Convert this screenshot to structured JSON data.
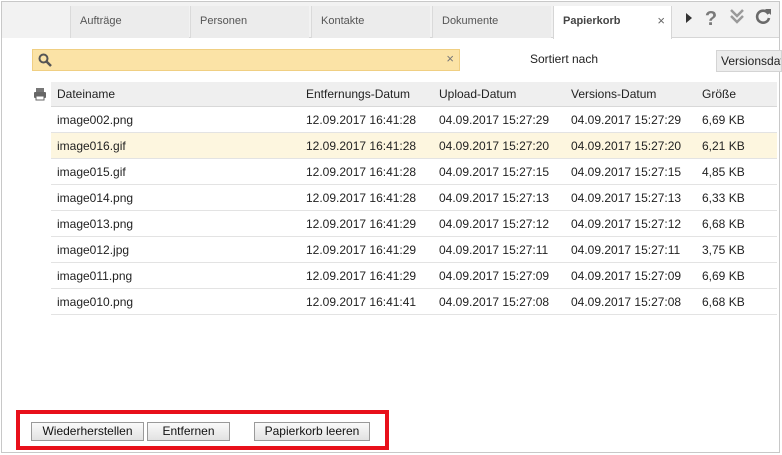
{
  "tabs": [
    {
      "label": "Aufträge"
    },
    {
      "label": "Personen"
    },
    {
      "label": "Kontakte"
    },
    {
      "label": "Dokumente"
    },
    {
      "label": "Papierkorb",
      "active": true
    }
  ],
  "toolbar_icons": [
    "play-icon",
    "help-icon",
    "chevrons-down-icon",
    "refresh-icon"
  ],
  "search": {
    "value": "",
    "placeholder": ""
  },
  "sort": {
    "label": "Sortiert nach",
    "selected": "Versionsdatum"
  },
  "table": {
    "columns": [
      "Dateiname",
      "Entfernungs-Datum",
      "Upload-Datum",
      "Versions-Datum",
      "Größe"
    ],
    "rows": [
      [
        "image002.png",
        "12.09.2017 16:41:28",
        "04.09.2017 15:27:29",
        "04.09.2017 15:27:29",
        "6,69 KB"
      ],
      [
        "image016.gif",
        "12.09.2017 16:41:28",
        "04.09.2017 15:27:20",
        "04.09.2017 15:27:20",
        "6,21 KB"
      ],
      [
        "image015.gif",
        "12.09.2017 16:41:28",
        "04.09.2017 15:27:15",
        "04.09.2017 15:27:15",
        "4,85 KB"
      ],
      [
        "image014.png",
        "12.09.2017 16:41:28",
        "04.09.2017 15:27:13",
        "04.09.2017 15:27:13",
        "6,33 KB"
      ],
      [
        "image013.png",
        "12.09.2017 16:41:29",
        "04.09.2017 15:27:12",
        "04.09.2017 15:27:12",
        "6,68 KB"
      ],
      [
        "image012.jpg",
        "12.09.2017 16:41:29",
        "04.09.2017 15:27:11",
        "04.09.2017 15:27:11",
        "3,75 KB"
      ],
      [
        "image011.png",
        "12.09.2017 16:41:29",
        "04.09.2017 15:27:09",
        "04.09.2017 15:27:09",
        "6,69 KB"
      ],
      [
        "image010.png",
        "12.09.2017 16:41:41",
        "04.09.2017 15:27:08",
        "04.09.2017 15:27:08",
        "6,68 KB"
      ]
    ],
    "selected_row": 1
  },
  "buttons": {
    "restore": "Wiederherstellen",
    "remove": "Entfernen",
    "empty_trash": "Papierkorb leeren"
  },
  "colors": {
    "search_bg": "#fbe3a6",
    "selected_row": "#fdf6df",
    "highlight_border": "#e8101a"
  }
}
